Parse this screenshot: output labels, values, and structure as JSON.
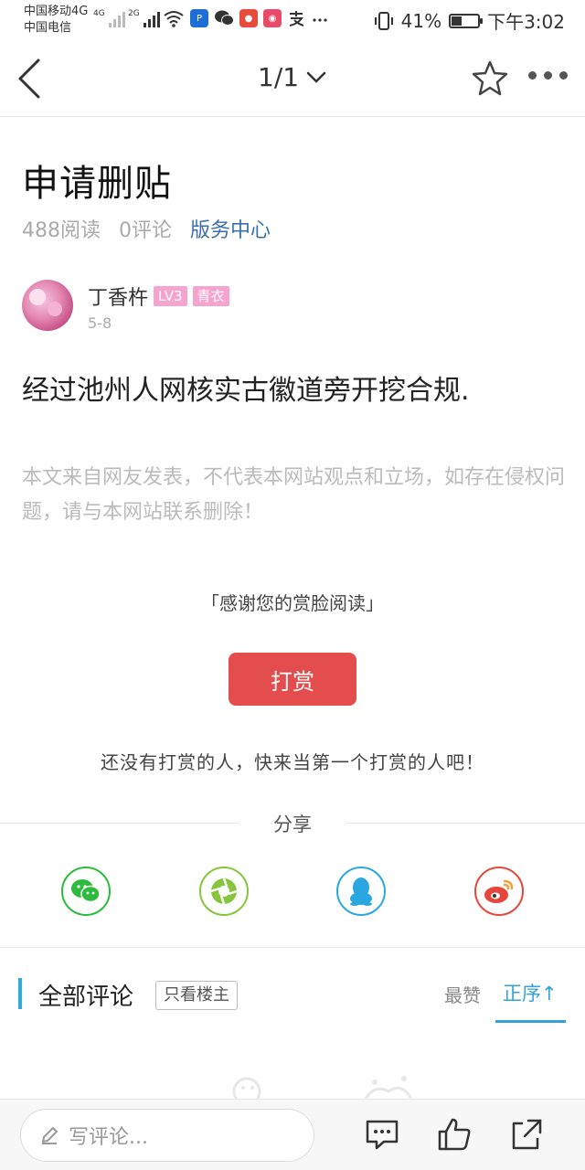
{
  "status_bar": {
    "carrier_1": "中国移动4G",
    "carrier_2": "中国电信",
    "net_1": "4G",
    "net_2": "2G",
    "battery": "41%",
    "battery_level": 0.41,
    "time": "下午3:02"
  },
  "nav": {
    "pager": "1/1"
  },
  "post": {
    "title": "申请删贴",
    "reads": "488阅读",
    "comments": "0评论",
    "board": "版务中心",
    "author": "丁香杵",
    "level": "LV3",
    "rank": "青衣",
    "date": "5-8",
    "content": "经过池州人网核实古徽道旁开挖合规.",
    "disclaimer": "本文来自网友发表，不代表本网站观点和立场，如存在侵权问题，请与本网站联系删除！"
  },
  "reward": {
    "thanks": "「感谢您的赏脸阅读」",
    "button": "打赏",
    "empty": "还没有打赏的人，快来当第一个打赏的人吧！"
  },
  "share": {
    "title": "分享",
    "targets": [
      "wechat-icon",
      "moments-icon",
      "qq-icon",
      "weibo-icon"
    ],
    "colors": {
      "wechat": "#2dbb3e",
      "moments": "#86c63c",
      "qq": "#2aa7e0",
      "weibo": "#e6463c"
    }
  },
  "comments": {
    "title": "全部评论",
    "only_host": "只看楼主",
    "sort_hot": "最赞",
    "sort_asc": "正序↑"
  },
  "bottom": {
    "input_placeholder": "写评论..."
  },
  "colors": {
    "accent": "#33a3d8",
    "reward": "#e34d4d",
    "board_link": "#3a6fa8",
    "badge": "#f5a3cf"
  }
}
